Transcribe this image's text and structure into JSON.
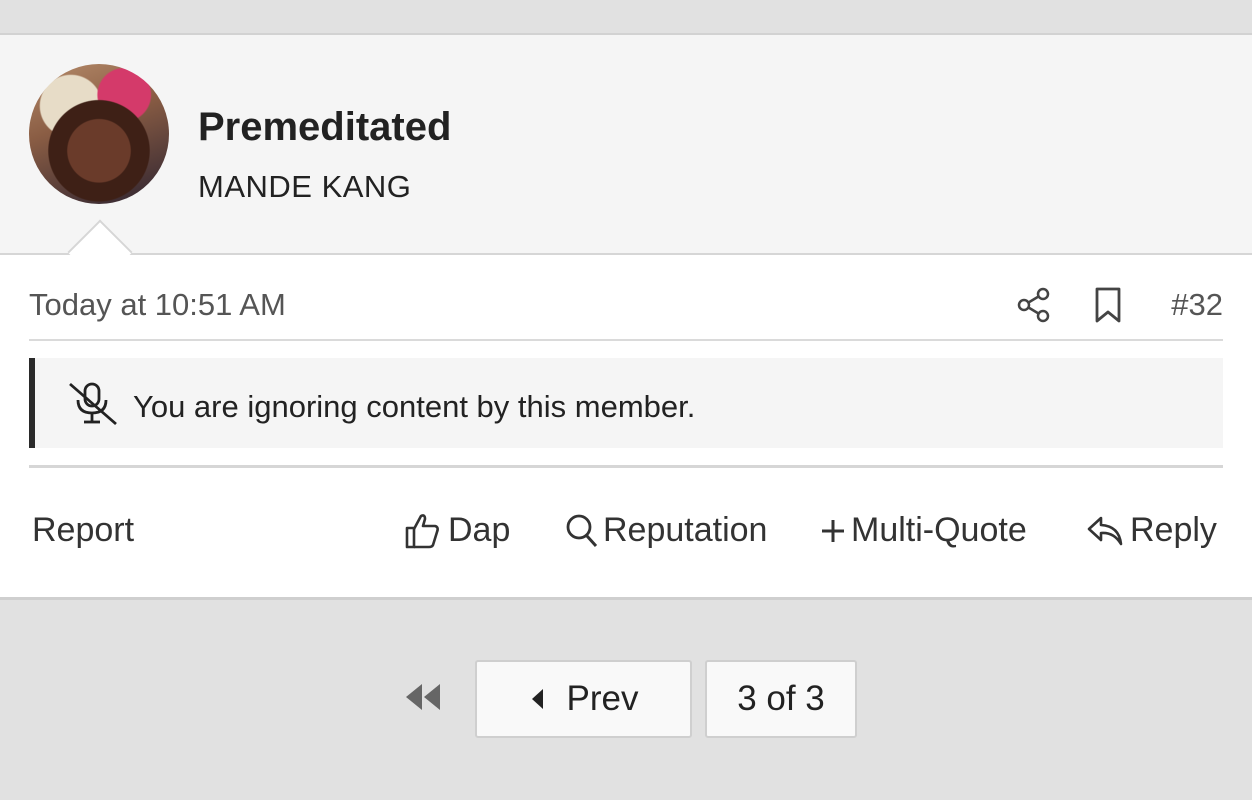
{
  "header": {
    "username": "Premeditated",
    "user_title": "MANDE KANG"
  },
  "post": {
    "timestamp": "Today at 10:51 AM",
    "number": "#32",
    "ignored_notice": "You are ignoring content by this member."
  },
  "actions": {
    "report": "Report",
    "dap": "Dap",
    "reputation": "Reputation",
    "multi_quote": "Multi-Quote",
    "reply": "Reply"
  },
  "pagination": {
    "prev": "Prev",
    "page_indicator": "3 of 3"
  },
  "icons": [
    "share-icon",
    "bookmark-icon",
    "mute-icon",
    "thumbs-up-icon",
    "search-icon",
    "plus-icon",
    "reply-icon",
    "first-page-icon",
    "caret-left-icon"
  ],
  "colors": {
    "header_bg": "#f5f5f5",
    "page_bg": "#e1e1e1",
    "notice_border": "#2a2a2a"
  }
}
